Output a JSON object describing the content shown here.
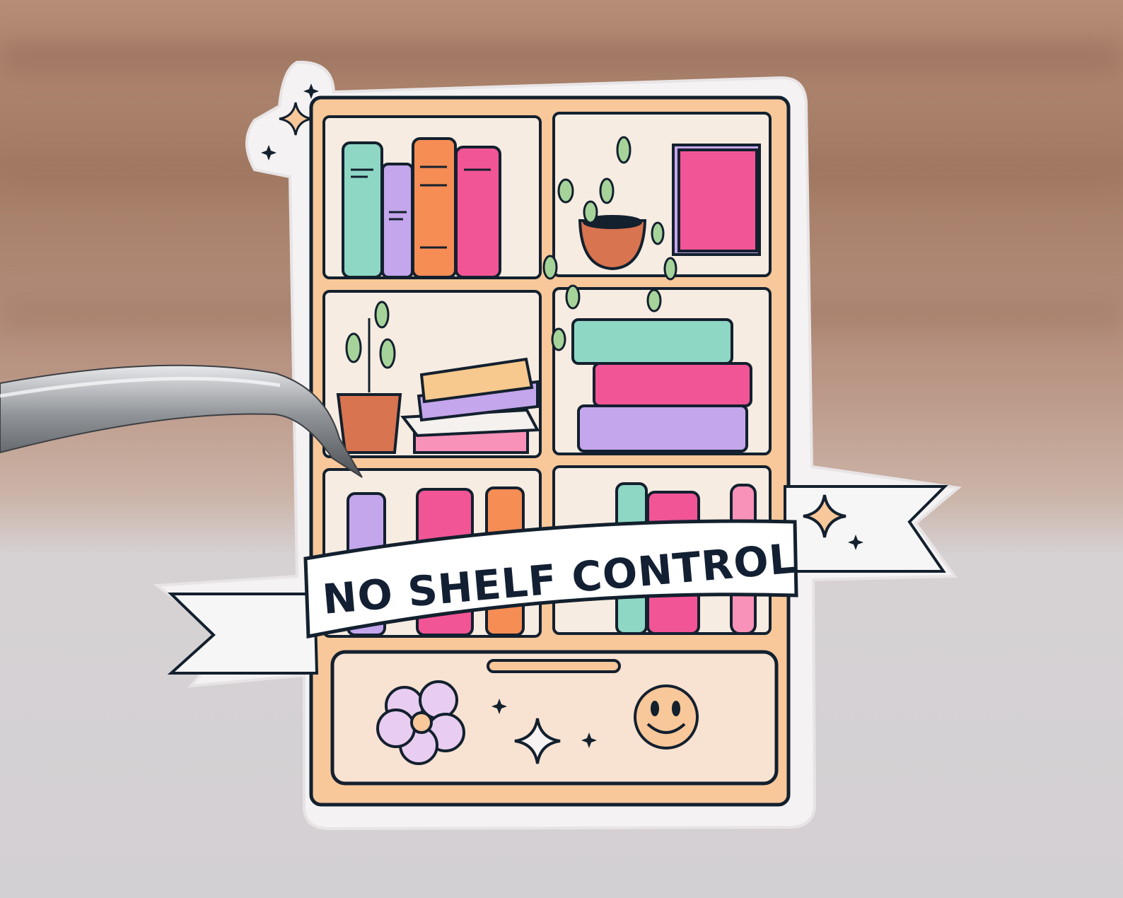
{
  "photo": {
    "background": {
      "wall_top": "#a9826b",
      "wall_mid": "#c9a897",
      "table": "#d9d6d8"
    },
    "subject": "holographic sticker held by tweezers",
    "palette": {
      "outline": "#13202e",
      "shelf": "#f8c89a",
      "cell_bg": "#f7ece1",
      "teal": "#8fd7c5",
      "lavender": "#c4a6ec",
      "orange": "#f58d55",
      "pink": "#f25596",
      "terracotta": "#d8744f",
      "leaf": "#a6d39a",
      "cream_book": "#f7c98e"
    }
  },
  "sticker": {
    "banner_text": "NO SHELF CONTROL",
    "drawer_icons": [
      "flower-icon",
      "sparkle-icon",
      "smiley-icon"
    ]
  }
}
